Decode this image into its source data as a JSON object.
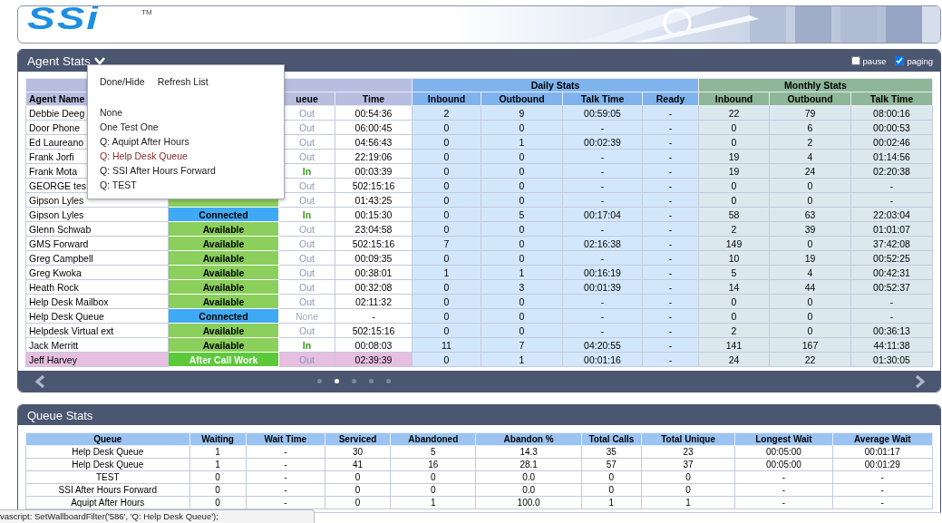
{
  "header": {
    "logo": "SSi",
    "trademark": "TM"
  },
  "agent_stats": {
    "title": "Agent Stats",
    "pause": {
      "label": "pause",
      "checked": false
    },
    "paging": {
      "label": "paging",
      "checked": true
    },
    "filter_menu": {
      "actions": [
        "Done/Hide",
        "Refresh List"
      ],
      "options": [
        {
          "label": "None",
          "selected": false
        },
        {
          "label": "One Test One",
          "selected": false
        },
        {
          "label": "Q: Aquipt After Hours",
          "selected": false
        },
        {
          "label": "Q: Help Desk Queue",
          "selected": true
        },
        {
          "label": "Q: SSI After Hours Forward",
          "selected": false
        },
        {
          "label": "Q: TEST",
          "selected": false
        }
      ]
    },
    "column_groups": [
      {
        "kind": "agent"
      },
      {
        "kind": "daily",
        "label": "Daily Stats"
      },
      {
        "kind": "monthly",
        "label": "Monthly Stats"
      }
    ],
    "columns": [
      "Agent Name",
      "",
      "ueue",
      "Time",
      "Inbound",
      "Outbound",
      "Talk Time",
      "Ready",
      "Inbound",
      "Outbound",
      "Talk Time"
    ],
    "rows": [
      {
        "name": "Debbie Deeg",
        "queue": {
          "text": "Out",
          "kind": "out"
        },
        "time": "00:54:36",
        "daily": [
          "2",
          "9",
          "00:59:05",
          "-"
        ],
        "monthly": [
          "22",
          "79",
          "08:00:16"
        ],
        "highlighted": false
      },
      {
        "name": "Door Phone",
        "queue": {
          "text": "Out",
          "kind": "out"
        },
        "time": "06:00:45",
        "daily": [
          "0",
          "0",
          "-",
          "-"
        ],
        "monthly": [
          "0",
          "6",
          "00:00:53"
        ],
        "highlighted": false
      },
      {
        "name": "Ed Laureano",
        "queue": {
          "text": "Out",
          "kind": "out"
        },
        "time": "04:56:43",
        "daily": [
          "0",
          "1",
          "00:02:39",
          "-"
        ],
        "monthly": [
          "0",
          "2",
          "00:02:46"
        ],
        "highlighted": false
      },
      {
        "name": "Frank Jorfi",
        "queue": {
          "text": "Out",
          "kind": "out"
        },
        "time": "22:19:06",
        "daily": [
          "0",
          "0",
          "-",
          "-"
        ],
        "monthly": [
          "19",
          "4",
          "01:14:56"
        ],
        "highlighted": false
      },
      {
        "name": "Frank Mota",
        "queue": {
          "text": "In",
          "kind": "in"
        },
        "time": "00:03:39",
        "daily": [
          "0",
          "0",
          "-",
          "-"
        ],
        "monthly": [
          "19",
          "24",
          "02:20:38"
        ],
        "highlighted": false
      },
      {
        "name": "GEORGE tes",
        "queue": {
          "text": "Out",
          "kind": "out"
        },
        "time": "502:15:16",
        "daily": [
          "0",
          "0",
          "-",
          "-"
        ],
        "monthly": [
          "0",
          "0",
          "-"
        ],
        "highlighted": false
      },
      {
        "name": "Gipson Lyles",
        "state": {
          "kind": "available"
        },
        "queue": {
          "text": "Out",
          "kind": "out"
        },
        "time": "01:43:25",
        "daily": [
          "0",
          "0",
          "-",
          "-"
        ],
        "monthly": [
          "0",
          "0",
          "-"
        ],
        "highlighted": false
      },
      {
        "name": "Gipson Lyles",
        "state": {
          "text": "Connected",
          "kind": "connected"
        },
        "queue": {
          "text": "In",
          "kind": "in"
        },
        "time": "00:15:30",
        "daily": [
          "0",
          "5",
          "00:17:04",
          "-"
        ],
        "monthly": [
          "58",
          "63",
          "22:03:04"
        ],
        "highlighted": false
      },
      {
        "name": "Glenn Schwab",
        "state": {
          "text": "Available",
          "kind": "available"
        },
        "queue": {
          "text": "Out",
          "kind": "out"
        },
        "time": "23:04:58",
        "daily": [
          "0",
          "0",
          "-",
          "-"
        ],
        "monthly": [
          "2",
          "39",
          "01:01:07"
        ],
        "highlighted": false
      },
      {
        "name": "GMS Forward",
        "state": {
          "text": "Available",
          "kind": "available"
        },
        "queue": {
          "text": "Out",
          "kind": "out"
        },
        "time": "502:15:16",
        "daily": [
          "7",
          "0",
          "02:16:38",
          "-"
        ],
        "monthly": [
          "149",
          "0",
          "37:42:08"
        ],
        "highlighted": false
      },
      {
        "name": "Greg Campbell",
        "state": {
          "text": "Available",
          "kind": "available"
        },
        "queue": {
          "text": "Out",
          "kind": "out"
        },
        "time": "00:09:35",
        "daily": [
          "0",
          "0",
          "-",
          "-"
        ],
        "monthly": [
          "10",
          "19",
          "00:52:25"
        ],
        "highlighted": false
      },
      {
        "name": "Greg Kwoka",
        "state": {
          "text": "Available",
          "kind": "available"
        },
        "queue": {
          "text": "Out",
          "kind": "out"
        },
        "time": "00:38:01",
        "daily": [
          "1",
          "1",
          "00:16:19",
          "-"
        ],
        "monthly": [
          "5",
          "4",
          "00:42:31"
        ],
        "highlighted": false
      },
      {
        "name": "Heath Rock",
        "state": {
          "text": "Available",
          "kind": "available"
        },
        "queue": {
          "text": "Out",
          "kind": "out"
        },
        "time": "00:32:08",
        "daily": [
          "0",
          "3",
          "00:01:39",
          "-"
        ],
        "monthly": [
          "14",
          "44",
          "00:52:37"
        ],
        "highlighted": false
      },
      {
        "name": "Help Desk Mailbox",
        "state": {
          "text": "Available",
          "kind": "available"
        },
        "queue": {
          "text": "Out",
          "kind": "out"
        },
        "time": "02:11:32",
        "daily": [
          "0",
          "0",
          "-",
          "-"
        ],
        "monthly": [
          "0",
          "0",
          "-"
        ],
        "highlighted": false
      },
      {
        "name": "Help Desk Queue",
        "state": {
          "text": "Connected",
          "kind": "connected"
        },
        "queue": {
          "text": "None",
          "kind": "none"
        },
        "time": "-",
        "daily": [
          "0",
          "0",
          "-",
          "-"
        ],
        "monthly": [
          "0",
          "0",
          "-"
        ],
        "highlighted": false
      },
      {
        "name": "Helpdesk Virtual ext",
        "state": {
          "text": "Available",
          "kind": "available"
        },
        "queue": {
          "text": "Out",
          "kind": "out"
        },
        "time": "502:15:16",
        "daily": [
          "0",
          "0",
          "-",
          "-"
        ],
        "monthly": [
          "2",
          "0",
          "00:36:13"
        ],
        "highlighted": false
      },
      {
        "name": "Jack Merritt",
        "state": {
          "text": "Available",
          "kind": "available"
        },
        "queue": {
          "text": "In",
          "kind": "in"
        },
        "time": "00:08:03",
        "daily": [
          "11",
          "7",
          "04:20:55",
          "-"
        ],
        "monthly": [
          "141",
          "167",
          "44:11:38"
        ],
        "highlighted": false
      },
      {
        "name": "Jeff Harvey",
        "state": {
          "text": "After Call Work",
          "kind": "after_call_work"
        },
        "queue": {
          "text": "Out",
          "kind": "out"
        },
        "time": "02:39:39",
        "daily": [
          "0",
          "1",
          "00:01:16",
          "-"
        ],
        "monthly": [
          "24",
          "22",
          "01:30:05"
        ],
        "highlighted": true
      }
    ],
    "pager": {
      "pages": [
        {
          "selected": false
        },
        {
          "selected": true
        },
        {
          "selected": false
        },
        {
          "selected": false
        },
        {
          "selected": false
        }
      ]
    }
  },
  "queue_stats": {
    "title": "Queue Stats",
    "columns": [
      "Queue",
      "Waiting",
      "Wait Time",
      "Serviced",
      "Abandoned",
      "Abandon %",
      "Total Calls",
      "Total Unique",
      "Longest Wait",
      "Average Wait"
    ],
    "rows": [
      [
        "Help Desk Queue",
        "1",
        "-",
        "30",
        "5",
        "14.3",
        "35",
        "23",
        "00:05:00",
        "00:01:17"
      ],
      [
        "Help Desk Queue",
        "1",
        "-",
        "41",
        "16",
        "28.1",
        "57",
        "37",
        "00:05:00",
        "00:01:29"
      ],
      [
        "TEST",
        "0",
        "-",
        "0",
        "0",
        "0.0",
        "0",
        "0",
        "-",
        "-"
      ],
      [
        "SSI After Hours Forward",
        "0",
        "-",
        "0",
        "0",
        "0.0",
        "0",
        "0",
        "-",
        "-"
      ],
      [
        "Aquipt After Hours",
        "0",
        "-",
        "0",
        "1",
        "100.0",
        "1",
        "1",
        "-",
        "-"
      ]
    ]
  },
  "status_bar": {
    "text": "vascript: SetWallboardFilter('586', 'Q: Help Desk Queue');"
  }
}
